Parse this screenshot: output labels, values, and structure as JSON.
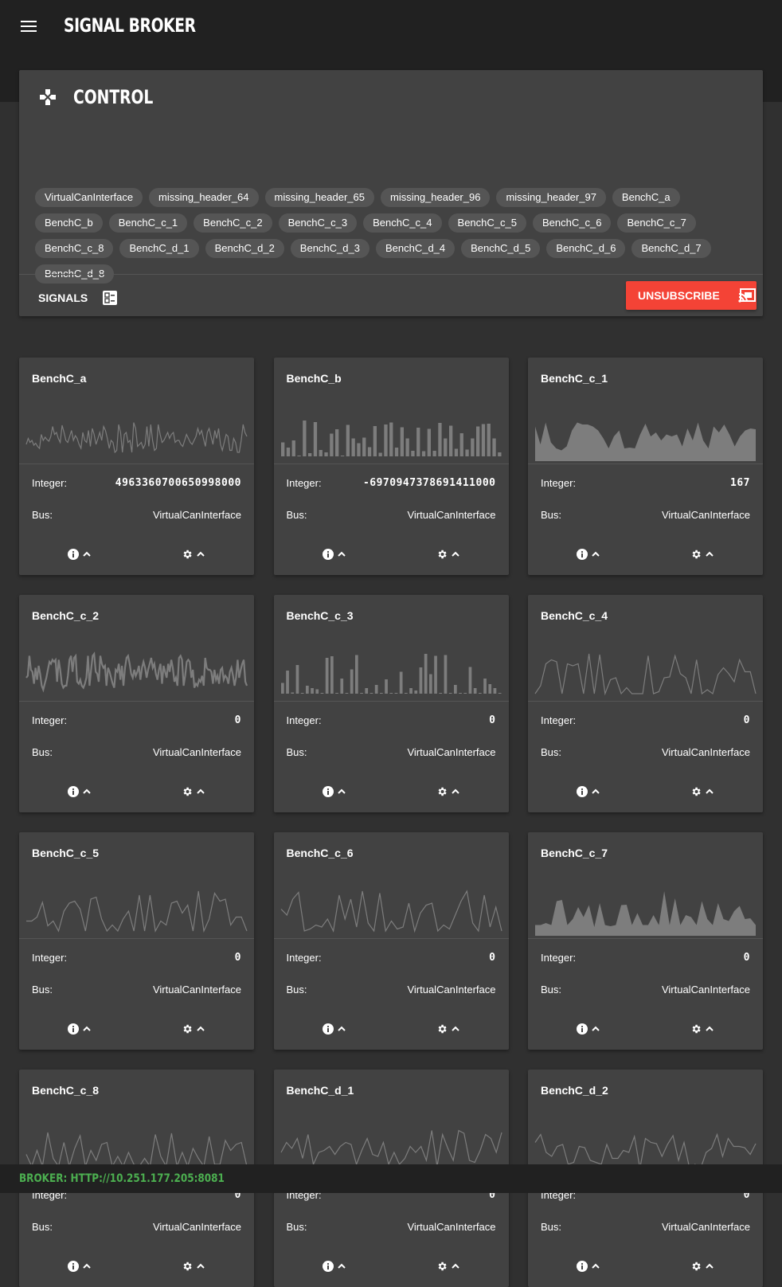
{
  "header": {
    "title": "Signal Broker",
    "menu_icon": "menu-icon"
  },
  "control": {
    "title": "Control",
    "icon": "gamepad-icon",
    "chips": [
      "VirtualCanInterface",
      "missing_header_64",
      "missing_header_65",
      "missing_header_96",
      "missing_header_97",
      "BenchC_a",
      "BenchC_b",
      "BenchC_c_1",
      "BenchC_c_2",
      "BenchC_c_3",
      "BenchC_c_4",
      "BenchC_c_5",
      "BenchC_c_6",
      "BenchC_c_7",
      "BenchC_c_8",
      "BenchC_d_1",
      "BenchC_d_2",
      "BenchC_d_3",
      "BenchC_d_4",
      "BenchC_d_5",
      "BenchC_d_6",
      "BenchC_d_7",
      "BenchC_d_8"
    ],
    "signals_label": "SIGNALS",
    "unsubscribe_label": "UNSUBSCRIBE",
    "unsubscribe_color": "#f44336"
  },
  "labels": {
    "integer": "Integer:",
    "bus": "Bus:"
  },
  "cards": [
    {
      "name": "BenchC_a",
      "integer": "4963360700650998000",
      "bus": "VirtualCanInterface",
      "chart": "line",
      "values": [
        30,
        45,
        35,
        40,
        28,
        33,
        25,
        20,
        55,
        40,
        48,
        42,
        38,
        50,
        75,
        55,
        60,
        45,
        35,
        78,
        60,
        40,
        35,
        50,
        65,
        40,
        52,
        45,
        30,
        20,
        60,
        40,
        35,
        65,
        25,
        70,
        55,
        30,
        45,
        60,
        40,
        75,
        65,
        45,
        20,
        40,
        35,
        10,
        15,
        80,
        60,
        10,
        55,
        60,
        35,
        40,
        10,
        85,
        70,
        25,
        30,
        35,
        20,
        30,
        75,
        25,
        80,
        40,
        15,
        20,
        80,
        55,
        35,
        40,
        50,
        60,
        45,
        55,
        60,
        35,
        40,
        40,
        30,
        25,
        40,
        55,
        45,
        35,
        30,
        40,
        50,
        70,
        55,
        65,
        45,
        25,
        60,
        70,
        50,
        30,
        65,
        45,
        70,
        30,
        15,
        35,
        55,
        50,
        15,
        15,
        45,
        35,
        10,
        10,
        40,
        80,
        60,
        50
      ],
      "max": 100
    },
    {
      "name": "BenchC_b",
      "integer": "-6970947378691411000",
      "bus": "VirtualCanInterface",
      "chart": "bar",
      "values": [
        35,
        22,
        40,
        2,
        90,
        8,
        86,
        16,
        10,
        57,
        68,
        1,
        79,
        45,
        33,
        47,
        23,
        76,
        9,
        80,
        85,
        22,
        73,
        45,
        14,
        72,
        13,
        69,
        14,
        84,
        45,
        77,
        19,
        58,
        17,
        45,
        75,
        81,
        82,
        45,
        10
      ],
      "max": 100
    },
    {
      "name": "BenchC_c_1",
      "integer": "167",
      "bus": "VirtualCanInterface",
      "chart": "area",
      "values": [
        75,
        30,
        85,
        35,
        20,
        15,
        25,
        65,
        85,
        80,
        80,
        75,
        65,
        45,
        20,
        50,
        65,
        20,
        22,
        20,
        55,
        82,
        50,
        60,
        40,
        55,
        50,
        55,
        25,
        70,
        40,
        85,
        40,
        20,
        75,
        60,
        80,
        55,
        25,
        50,
        65,
        70,
        68
      ],
      "max": 100
    },
    {
      "name": "BenchC_c_2",
      "integer": "0",
      "bus": "VirtualCanInterface",
      "chart": "line-thick",
      "values": [
        40,
        45,
        95,
        60,
        55,
        25,
        65,
        35,
        70,
        50,
        20,
        10,
        25,
        40,
        60,
        80,
        75,
        85,
        80,
        85,
        30,
        85,
        60,
        25,
        15,
        20,
        20,
        45,
        85,
        95,
        55,
        90,
        95,
        30,
        25,
        35,
        20,
        15,
        25,
        40,
        95,
        20,
        60,
        95,
        100,
        55,
        50,
        30,
        95,
        75,
        65,
        70,
        20,
        65,
        55,
        40,
        25,
        15,
        60,
        55,
        75,
        35,
        70,
        20,
        65,
        90,
        95,
        75,
        50,
        40,
        60,
        45,
        55,
        70,
        35,
        65,
        80,
        65,
        40,
        60,
        75,
        90,
        65,
        75,
        50,
        35,
        60,
        75,
        25,
        70,
        55,
        40,
        75,
        55,
        85,
        65,
        30,
        40,
        20,
        90,
        95,
        85,
        20,
        45,
        80,
        85,
        80,
        40,
        60,
        15,
        25,
        20,
        35,
        30,
        45,
        20,
        90,
        65,
        60,
        60,
        55,
        25,
        60,
        35,
        45,
        25,
        60,
        65,
        35,
        45,
        40,
        25,
        55,
        65,
        45,
        20,
        40,
        85,
        40,
        60,
        75,
        85,
        30,
        20
      ],
      "max": 100
    },
    {
      "name": "BenchC_c_3",
      "integer": "0",
      "bus": "VirtualCanInterface",
      "chart": "bar",
      "values": [
        27,
        58,
        3,
        72,
        0,
        20,
        14,
        11,
        0,
        90,
        94,
        0,
        38,
        0,
        61,
        97,
        0,
        14,
        0,
        22,
        0,
        36,
        0,
        0,
        55,
        0,
        14,
        8,
        66,
        100,
        49,
        95,
        0,
        97,
        0,
        22,
        0,
        0,
        67,
        14,
        1,
        38,
        24,
        14,
        2
      ],
      "max": 100
    },
    {
      "name": "BenchC_c_4",
      "integer": "0",
      "bus": "VirtualCanInterface",
      "chart": "line",
      "values": [
        0,
        20,
        75,
        85,
        80,
        0,
        75,
        70,
        75,
        0,
        100,
        0,
        98,
        0,
        35,
        40,
        0,
        15,
        0,
        0,
        0,
        95,
        0,
        5,
        40,
        42,
        95,
        50,
        40,
        0,
        85,
        0,
        10,
        0,
        48,
        65,
        50,
        30,
        85,
        55,
        55,
        0
      ],
      "max": 100
    },
    {
      "name": "BenchC_c_5",
      "integer": "0",
      "bus": "VirtualCanInterface",
      "chart": "line",
      "values": [
        25,
        25,
        35,
        72,
        13,
        25,
        0,
        50,
        70,
        75,
        55,
        0,
        80,
        85,
        30,
        0,
        15,
        0,
        30,
        50,
        0,
        90,
        0,
        90,
        0,
        25,
        15,
        70,
        75,
        45,
        65,
        0,
        100,
        0,
        30,
        95,
        75,
        80,
        15,
        35,
        35,
        0
      ],
      "max": 100
    },
    {
      "name": "BenchC_c_6",
      "integer": "0",
      "bus": "VirtualCanInterface",
      "chart": "line",
      "values": [
        55,
        40,
        80,
        97,
        0,
        5,
        15,
        10,
        30,
        0,
        90,
        30,
        80,
        10,
        100,
        20,
        0,
        95,
        0,
        25,
        5,
        10,
        70,
        0,
        45,
        65,
        70,
        0,
        15,
        5,
        40,
        75,
        100,
        20,
        0,
        90,
        10,
        60,
        0
      ],
      "max": 100
    },
    {
      "name": "BenchC_c_7",
      "integer": "0",
      "bus": "VirtualCanInterface",
      "chart": "area",
      "values": [
        15,
        15,
        20,
        15,
        75,
        78,
        15,
        30,
        60,
        35,
        65,
        10,
        70,
        15,
        12,
        15,
        65,
        66,
        15,
        45,
        15,
        15,
        40,
        15,
        100,
        15,
        82,
        15,
        40,
        35,
        15,
        75,
        30,
        15,
        70,
        30,
        25,
        50,
        63,
        30,
        32,
        15
      ],
      "max": 100
    },
    {
      "name": "BenchC_c_8",
      "integer": "0",
      "bus": "VirtualCanInterface",
      "chart": "line",
      "values": [
        35,
        5,
        45,
        5,
        90,
        25,
        5,
        65,
        5,
        50,
        82,
        5,
        45,
        20,
        60,
        65,
        5,
        30,
        5,
        40,
        10,
        5,
        25,
        5,
        85,
        30,
        5,
        88,
        5,
        40,
        5,
        50,
        25,
        5,
        80,
        10,
        10,
        70,
        45,
        60,
        65,
        5
      ],
      "max": 100
    },
    {
      "name": "BenchC_d_1",
      "integer": "0",
      "bus": "VirtualCanInterface",
      "chart": "line",
      "values": [
        40,
        65,
        50,
        75,
        25,
        85,
        10,
        40,
        45,
        55,
        35,
        55,
        65,
        60,
        10,
        45,
        75,
        35,
        30,
        65,
        10,
        40,
        10,
        25,
        55,
        40,
        55,
        20,
        95,
        5,
        85,
        50,
        20,
        95,
        88,
        20,
        15,
        45,
        85,
        75,
        40,
        90
      ],
      "max": 100
    },
    {
      "name": "BenchC_d_2",
      "integer": "0",
      "bus": "VirtualCanInterface",
      "chart": "line",
      "values": [
        65,
        85,
        40,
        30,
        55,
        60,
        10,
        15,
        55,
        52,
        20,
        15,
        10,
        60,
        25,
        25,
        45,
        40,
        80,
        0,
        75,
        65,
        62,
        30,
        60,
        82,
        20,
        65,
        0,
        10,
        0,
        40,
        50,
        85,
        30,
        75,
        55,
        55,
        52,
        35,
        62
      ],
      "max": 100
    }
  ],
  "footer": {
    "broker": "BROKER: HTTP://10.251.177.205:8081",
    "broker_color": "#4caf50"
  }
}
